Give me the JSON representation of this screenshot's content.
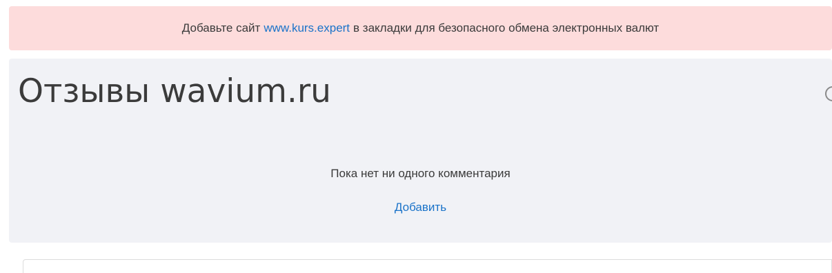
{
  "banner": {
    "text_before": "Добавьте сайт",
    "link": "www.kurs.expert",
    "text_after": "в закладки для безопасного обмена электронных валют"
  },
  "reviews": {
    "title": "Отзывы wavium.ru",
    "empty_text": "Пока нет ни одного комментария",
    "add_label": "Добавить"
  }
}
